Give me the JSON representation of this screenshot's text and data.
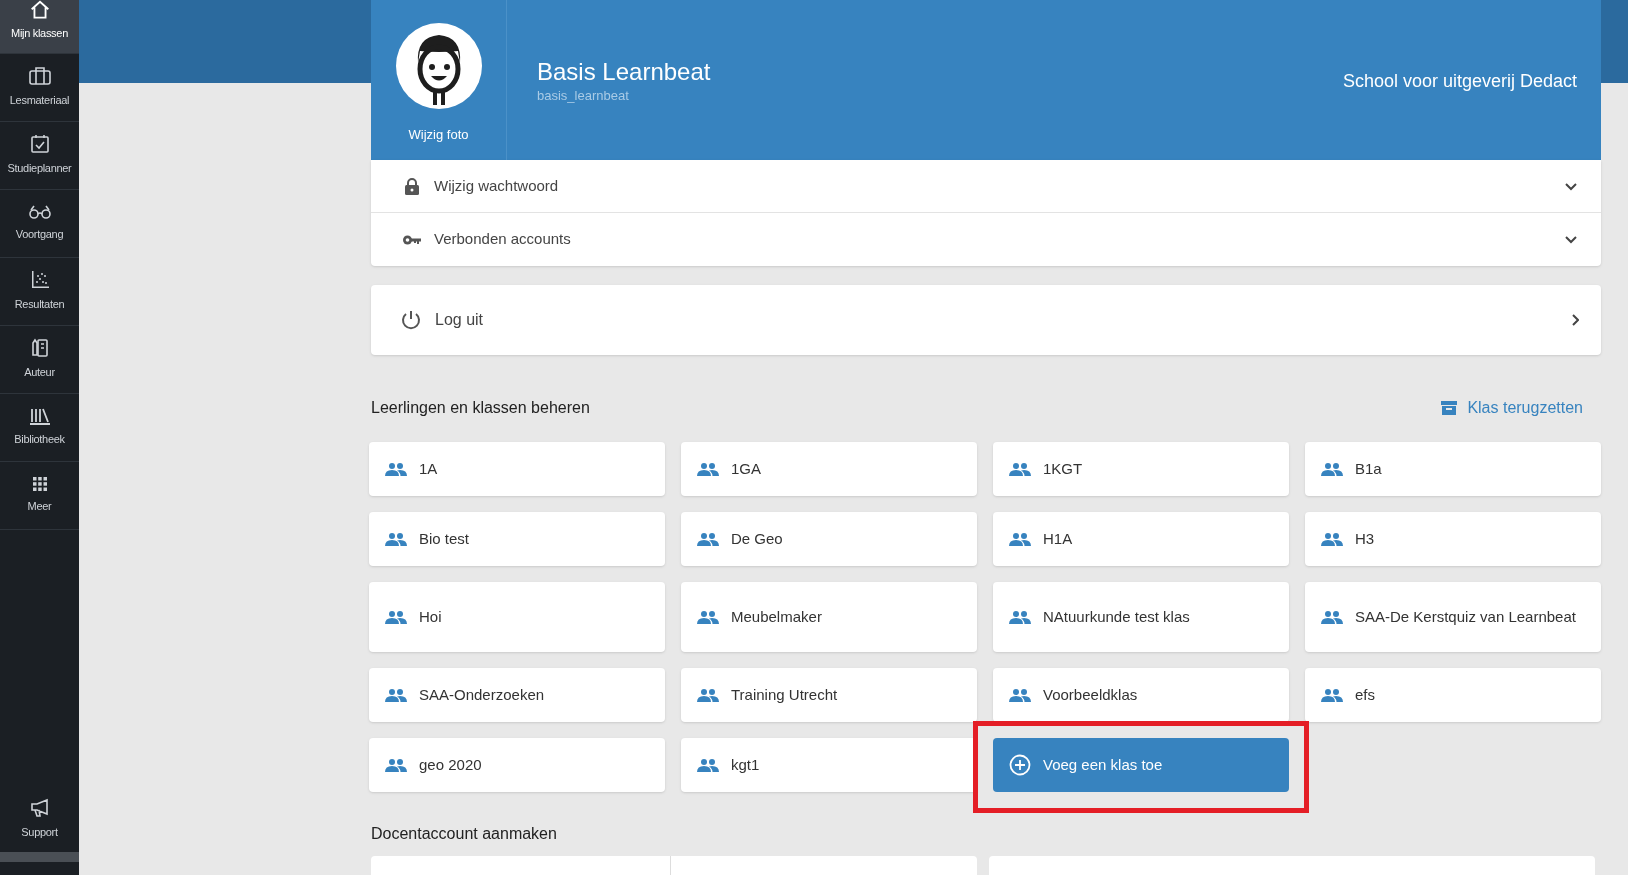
{
  "sidebar": {
    "items": [
      {
        "label": "Mijn klassen",
        "selected": true
      },
      {
        "label": "Lesmateriaal",
        "selected": false
      },
      {
        "label": "Studieplanner",
        "selected": false
      },
      {
        "label": "Voortgang",
        "selected": false
      },
      {
        "label": "Resultaten",
        "selected": false
      },
      {
        "label": "Auteur",
        "selected": false
      },
      {
        "label": "Bibliotheek",
        "selected": false
      },
      {
        "label": "Meer",
        "selected": false
      }
    ],
    "bottom_items": [
      {
        "label": "Support",
        "selected": false
      }
    ]
  },
  "profile": {
    "photo_button": "Wijzig foto",
    "name": "Basis Learnbeat",
    "username": "basis_learnbeat",
    "school": "School voor uitgeverij Dedact"
  },
  "settings": [
    {
      "label": "Wijzig wachtwoord",
      "expanded": false
    },
    {
      "label": "Verbonden accounts",
      "expanded": false
    }
  ],
  "logout": {
    "label": "Log uit"
  },
  "classes": {
    "title": "Leerlingen en klassen beheren",
    "restore_link": "Klas terugzetten",
    "items": [
      "1A",
      "1GA",
      "1KGT",
      "B1a",
      "Bio test",
      "De Geo",
      "H1A",
      "H3",
      "Hoi",
      "Meubelmaker",
      "NAtuurkunde test klas",
      "SAA-De Kerstquiz van Learnbeat",
      "SAA-Onderzoeken",
      "Training Utrecht",
      "Voorbeeldklas",
      "efs",
      "geo 2020",
      "kgt1"
    ],
    "add_button": {
      "label": "Voeg een klas toe",
      "highlighted": true
    }
  },
  "teacher_section": {
    "title": "Docentaccount aanmaken"
  }
}
